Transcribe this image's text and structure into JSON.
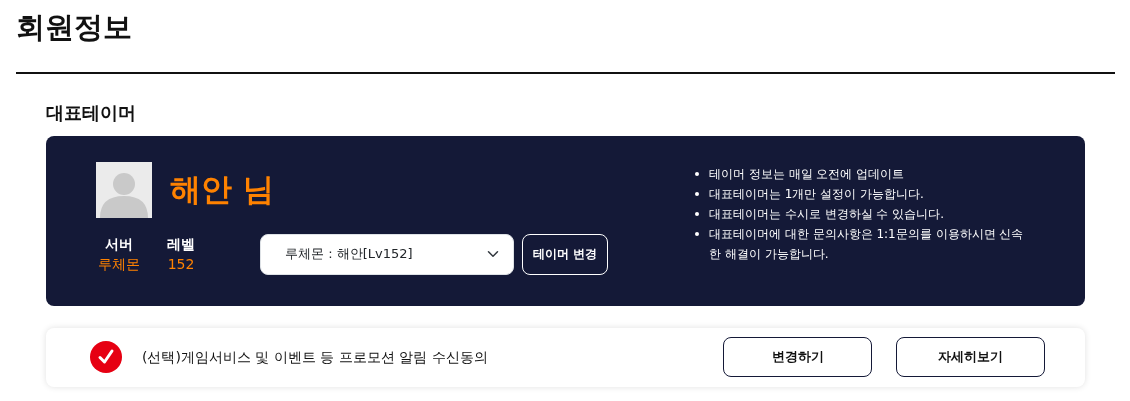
{
  "page_title": "회원정보",
  "section_title": "대표테이머",
  "profile": {
    "name": "해안 님",
    "stats": [
      {
        "label": "서버",
        "value": "루체몬"
      },
      {
        "label": "레벨",
        "value": "152"
      }
    ],
    "tamer_select": {
      "value": "루체몬 : 해안[Lv152]"
    },
    "change_button": "테이머 변경"
  },
  "notes": [
    "테이머 정보는 매일 오전에 업데이트",
    "대표테이머는 1개만 설정이 가능합니다.",
    "대표테이머는 수시로 변경하실 수 있습니다.",
    "대표테이머에 대한 문의사항은 1:1문의를 이용하시면 신속한 해결이 가능합니다."
  ],
  "consent": {
    "checked": true,
    "label": "(선택)게임서비스 및 이벤트 등 프로모션 알림 수신동의",
    "buttons": [
      "변경하기",
      "자세히보기"
    ]
  }
}
